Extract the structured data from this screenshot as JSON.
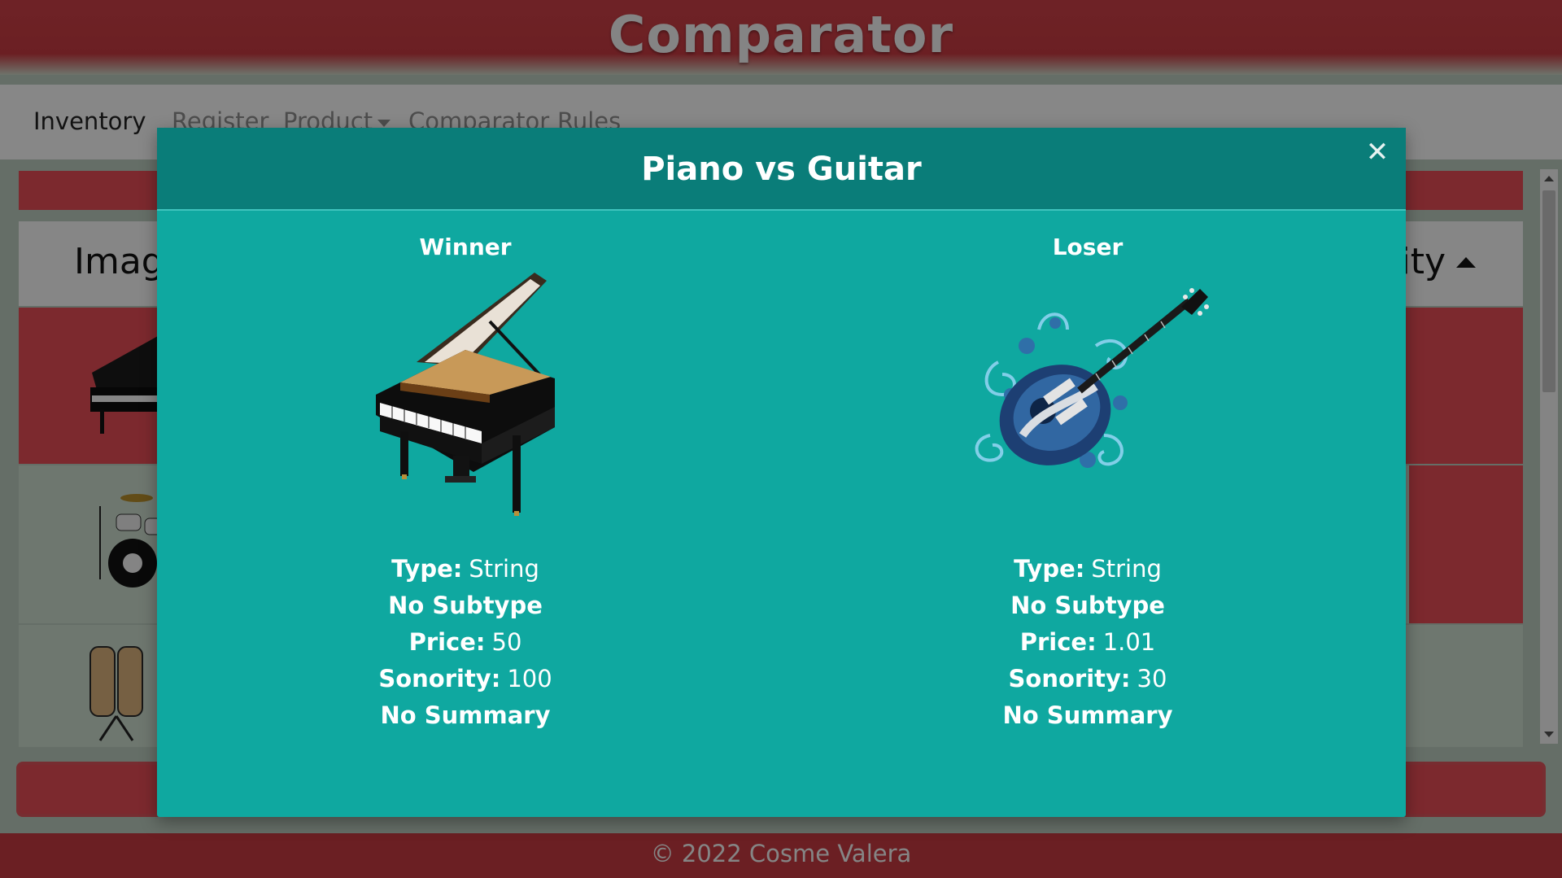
{
  "app": {
    "title": "Comparator",
    "footer": "© 2022 Cosme Valera"
  },
  "nav": {
    "items": [
      {
        "label": "Inventory"
      },
      {
        "label": "Register"
      },
      {
        "label": "Product"
      },
      {
        "label": "Comparator"
      },
      {
        "label": "Rules"
      }
    ]
  },
  "table": {
    "col_image": "Image",
    "col_sonority": "Sonority"
  },
  "modal": {
    "title": "Piano vs Guitar",
    "close_icon": "close-icon",
    "winner": {
      "label": "Winner",
      "image": "grand-piano",
      "type_label": "Type:",
      "type_value": "String",
      "subtype": "No Subtype",
      "price_label": "Price:",
      "price_value": "50",
      "sonority_label": "Sonority:",
      "sonority_value": "100",
      "summary": "No Summary"
    },
    "loser": {
      "label": "Loser",
      "image": "electric-guitar",
      "type_label": "Type:",
      "type_value": "String",
      "subtype": "No Subtype",
      "price_label": "Price:",
      "price_value": "1.01",
      "sonority_label": "Sonority:",
      "sonority_value": "30",
      "summary": "No Summary"
    }
  },
  "colors": {
    "brand_red": "#c43a41",
    "row_red": "#e24c55",
    "modal_teal": "#0fa8a0",
    "modal_header": "#0a7d79"
  }
}
